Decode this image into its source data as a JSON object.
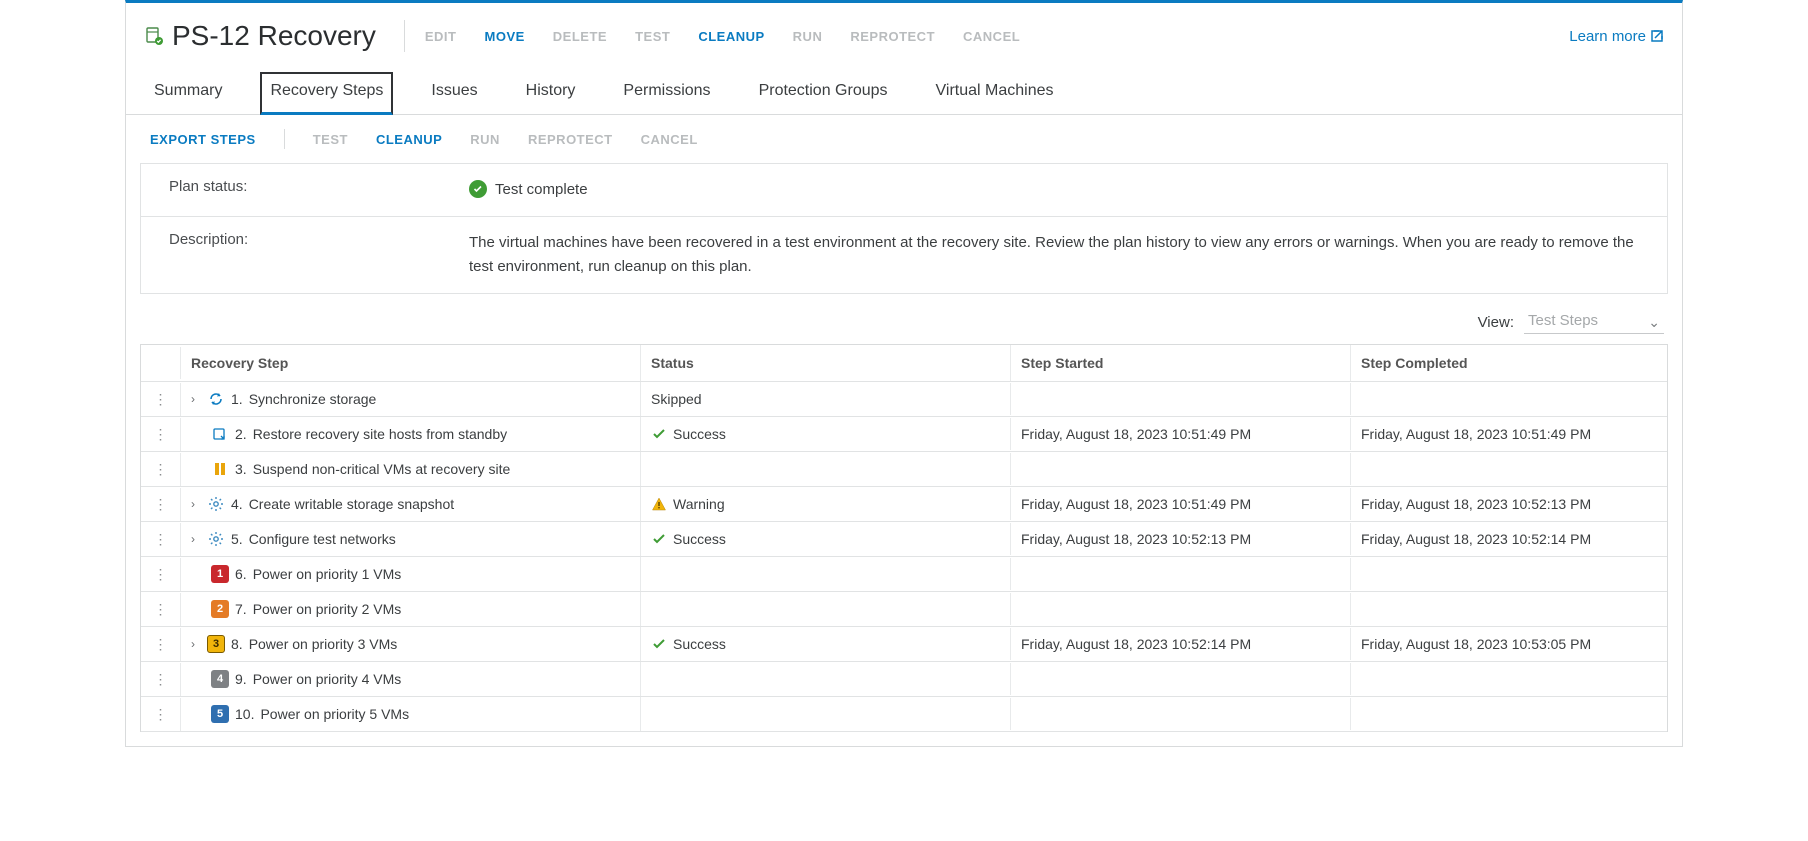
{
  "header": {
    "title": "PS-12 Recovery",
    "learn_more": "Learn more",
    "actions": {
      "edit": "EDIT",
      "move": "MOVE",
      "delete": "DELETE",
      "test": "TEST",
      "cleanup": "CLEANUP",
      "run": "RUN",
      "reprotect": "REPROTECT",
      "cancel": "CANCEL"
    }
  },
  "tabs": {
    "summary": "Summary",
    "recovery_steps": "Recovery Steps",
    "issues": "Issues",
    "history": "History",
    "permissions": "Permissions",
    "protection_groups": "Protection Groups",
    "virtual_machines": "Virtual Machines"
  },
  "sub_actions": {
    "export_steps": "EXPORT STEPS",
    "test": "TEST",
    "cleanup": "CLEANUP",
    "run": "RUN",
    "reprotect": "REPROTECT",
    "cancel": "CANCEL"
  },
  "status": {
    "plan_status_label": "Plan status:",
    "plan_status_value": "Test complete",
    "description_label": "Description:",
    "description_value": "The virtual machines have been recovered in a test environment at the recovery site. Review the plan history to view any errors or warnings. When you are ready to remove the test environment, run cleanup on this plan."
  },
  "view": {
    "label": "View:",
    "selected": "Test Steps"
  },
  "table": {
    "headers": {
      "recovery_step": "Recovery Step",
      "status": "Status",
      "step_started": "Step Started",
      "step_completed": "Step Completed"
    },
    "status_labels": {
      "skipped": "Skipped",
      "success": "Success",
      "warning": "Warning"
    },
    "rows": [
      {
        "num": "1.",
        "name": "Synchronize storage",
        "expandable": true
      },
      {
        "num": "2.",
        "name": "Restore recovery site hosts from standby",
        "started": "Friday, August 18, 2023 10:51:49 PM",
        "completed": "Friday, August 18, 2023 10:51:49 PM"
      },
      {
        "num": "3.",
        "name": "Suspend non-critical VMs at recovery site"
      },
      {
        "num": "4.",
        "name": "Create writable storage snapshot",
        "expandable": true,
        "started": "Friday, August 18, 2023 10:51:49 PM",
        "completed": "Friday, August 18, 2023 10:52:13 PM"
      },
      {
        "num": "5.",
        "name": "Configure test networks",
        "expandable": true,
        "started": "Friday, August 18, 2023 10:52:13 PM",
        "completed": "Friday, August 18, 2023 10:52:14 PM"
      },
      {
        "num": "6.",
        "name": "Power on priority 1 VMs"
      },
      {
        "num": "7.",
        "name": "Power on priority 2 VMs"
      },
      {
        "num": "8.",
        "name": "Power on priority 3 VMs",
        "expandable": true,
        "started": "Friday, August 18, 2023 10:52:14 PM",
        "completed": "Friday, August 18, 2023 10:53:05 PM"
      },
      {
        "num": "9.",
        "name": "Power on priority 4 VMs"
      },
      {
        "num": "10.",
        "name": "Power on priority 5 VMs"
      }
    ]
  }
}
